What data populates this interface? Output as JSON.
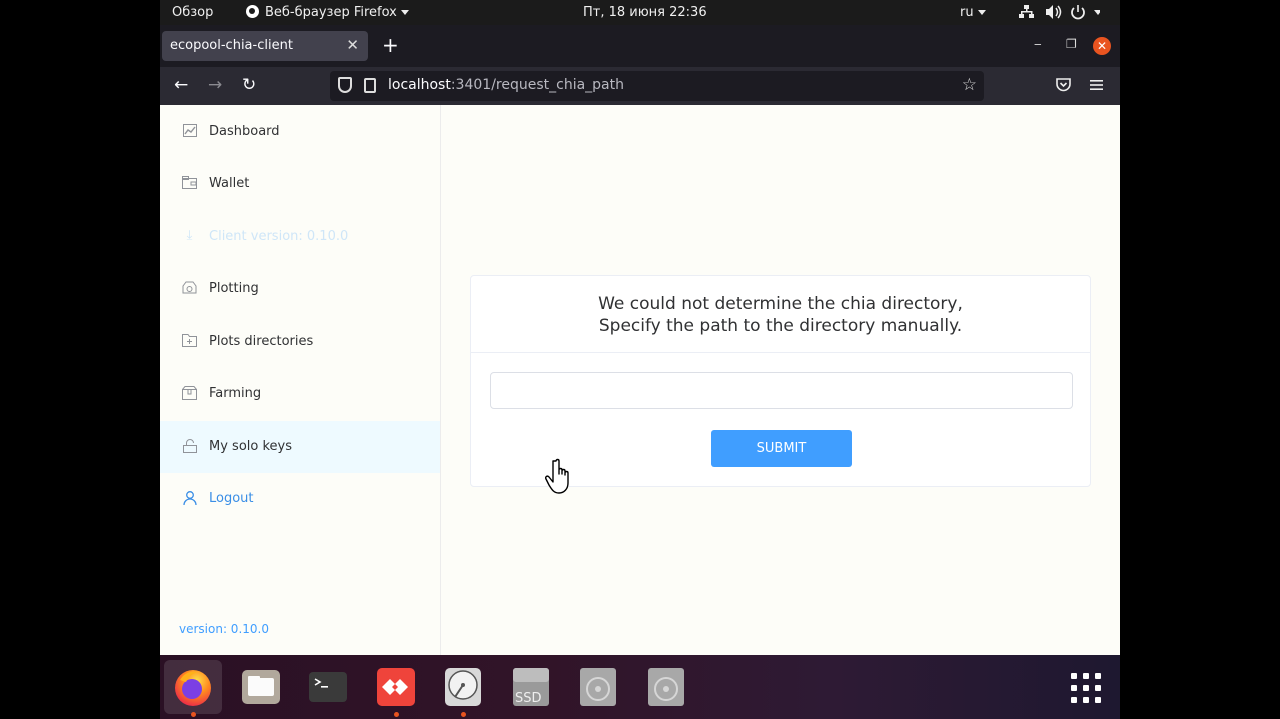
{
  "topbar": {
    "activities": "Обзор",
    "app_menu": "Веб-браузер Firefox",
    "clock": "Пт, 18 июня  22:36",
    "language": "ru"
  },
  "browser": {
    "tab_title": "ecopool-chia-client",
    "url_host": "localhost",
    "url_rest": ":3401/request_chia_path"
  },
  "sidebar": {
    "items": [
      {
        "label": "Dashboard",
        "icon": "chart-icon"
      },
      {
        "label": "Wallet",
        "icon": "wallet-icon"
      },
      {
        "label": "Client version: 0.10.0",
        "icon": "download-icon"
      },
      {
        "label": "Plotting",
        "icon": "plotting-icon"
      },
      {
        "label": "Plots directories",
        "icon": "folder-add-icon"
      },
      {
        "label": "Farming",
        "icon": "box-icon"
      },
      {
        "label": "My solo keys",
        "icon": "lock-icon"
      },
      {
        "label": "Logout",
        "icon": "user-icon"
      }
    ],
    "version": "version: 0.10.0"
  },
  "card": {
    "line1": "We could not determine the chia directory,",
    "line2": "Specify the path to the directory manually.",
    "input_value": "",
    "submit_label": "SUBMIT"
  },
  "dock": {
    "apps": [
      "firefox",
      "files",
      "terminal",
      "anydesk",
      "disks",
      "ssd-drive",
      "optical-drive-1",
      "optical-drive-2"
    ],
    "disk_label": "SSD"
  },
  "colors": {
    "accent": "#409eff",
    "ubuntu_orange": "#e95420"
  }
}
